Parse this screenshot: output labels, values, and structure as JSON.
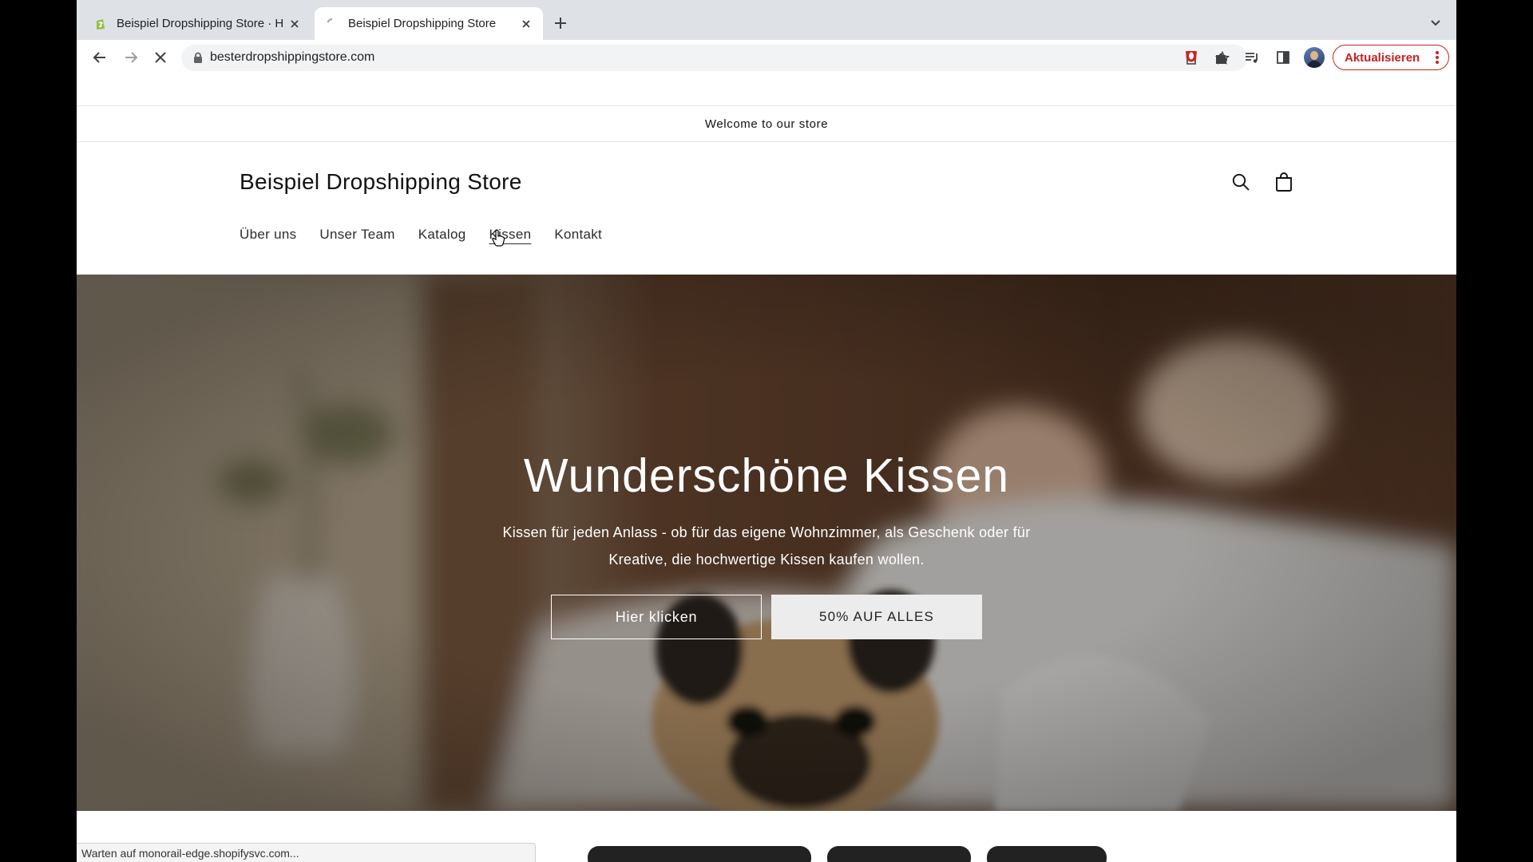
{
  "browser": {
    "tabs": [
      {
        "title": "Beispiel Dropshipping Store · H",
        "favicon": "shopify-icon",
        "active": false
      },
      {
        "title": "Beispiel Dropshipping Store",
        "favicon": "loading-spinner-icon",
        "active": true
      }
    ],
    "url": "besterdropshippingstore.com",
    "update_label": "Aktualisieren",
    "status_text": "Warten auf monorail-edge.shopifysvc.com..."
  },
  "store": {
    "announcement": "Welcome to our store",
    "name": "Beispiel Dropshipping Store",
    "nav": [
      "Über uns",
      "Unser Team",
      "Katalog",
      "Kissen",
      "Kontakt"
    ],
    "active_nav": "Kissen",
    "hero": {
      "title": "Wunderschöne Kissen",
      "subtitle": "Kissen für jeden Anlass - ob für das eigene Wohnzimmer, als Geschenk oder für Kreative, die hochwertige Kissen kaufen wollen.",
      "button_primary": "Hier klicken",
      "button_secondary": "50% AUF ALLES"
    }
  },
  "colors": {
    "update_accent": "#c5221f",
    "tab_strip": "#dee1e6",
    "omnibox": "#f1f3f4"
  }
}
